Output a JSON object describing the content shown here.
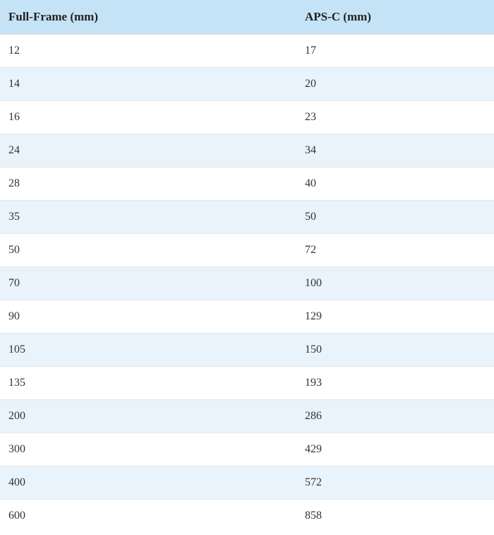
{
  "chart_data": {
    "type": "table",
    "columns": [
      "Full-Frame (mm)",
      "APS-C (mm)"
    ],
    "rows": [
      [
        12,
        17
      ],
      [
        14,
        20
      ],
      [
        16,
        23
      ],
      [
        24,
        34
      ],
      [
        28,
        40
      ],
      [
        35,
        50
      ],
      [
        50,
        72
      ],
      [
        70,
        100
      ],
      [
        90,
        129
      ],
      [
        105,
        150
      ],
      [
        135,
        193
      ],
      [
        200,
        286
      ],
      [
        300,
        429
      ],
      [
        400,
        572
      ],
      [
        600,
        858
      ]
    ]
  }
}
